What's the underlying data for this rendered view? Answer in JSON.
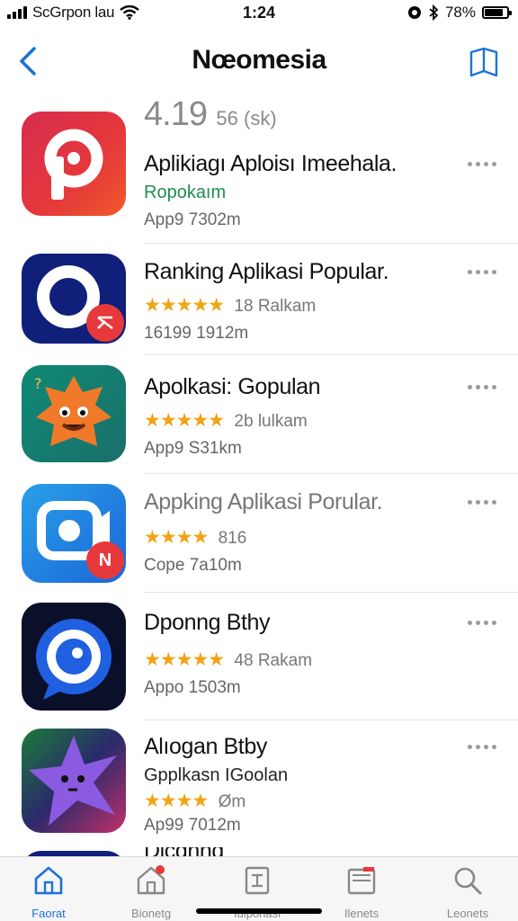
{
  "status": {
    "carrier": "ScGrpon lau",
    "time": "1:24",
    "battery": "78%"
  },
  "nav": {
    "title": "Nœomesia"
  },
  "header_rating": {
    "value": "4.19",
    "count": "56 (sk)"
  },
  "apps": [
    {
      "name": "Aplikiagı Aploisı Imeehala.",
      "sub": "Ropokaım",
      "sub_style": "green",
      "meta": "App9 7302m"
    },
    {
      "name": "Ranking Aplikasi Popular.",
      "stars": "★★★★★",
      "stars_text": "18 Ralkam",
      "meta": "16199 1912m"
    },
    {
      "name": "Apolkasi: Gopulan",
      "stars": "★★★★★",
      "stars_text": "2b lulkam",
      "meta": "App9 S31km"
    },
    {
      "name": "Appking Aplikasi Porular.",
      "stars": "★★★★",
      "stars_text": "816",
      "meta": "Cope 7a10m"
    },
    {
      "name": "Dponng Bthy",
      "stars": "★★★★★",
      "stars_text": "48 Rakam",
      "meta": "Appo 1503m"
    },
    {
      "name": "Alıogan Btby",
      "sub": "Gpplkasn IGoolan",
      "stars": "★★★★",
      "stars_text": "Øm",
      "meta": "Ap99 7012m"
    },
    {
      "name": "Dlcdnnd"
    }
  ],
  "badges": {
    "app2": "",
    "app4": "N"
  },
  "tabs": [
    {
      "label": "Faorat",
      "icon": "home-icon",
      "active": true
    },
    {
      "label": "Bionetg",
      "icon": "home-badge-icon"
    },
    {
      "label": "Iuiponasi",
      "icon": "document-icon"
    },
    {
      "label": "Ilenets",
      "icon": "inbox-icon"
    },
    {
      "label": "Leonets",
      "icon": "search-icon"
    }
  ],
  "colors": {
    "accent": "#1a73d9",
    "star": "#f2a313",
    "green_sub": "#1e8c52"
  }
}
